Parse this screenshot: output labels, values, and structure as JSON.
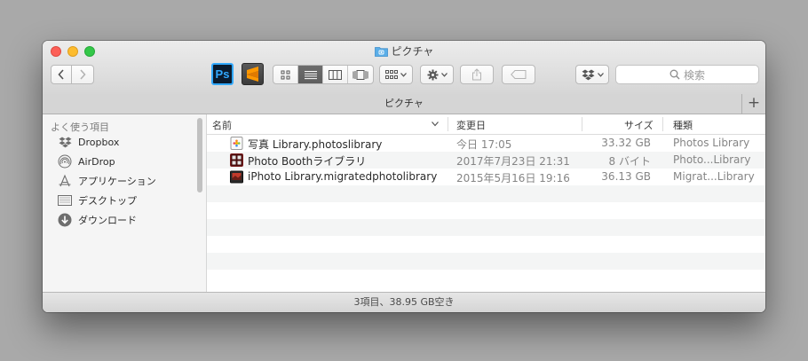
{
  "window": {
    "title": "ピクチャ"
  },
  "toolbar": {
    "back_label": "back",
    "forward_label": "forward",
    "apps": [
      "Ps",
      "S"
    ],
    "search_placeholder": "検索"
  },
  "tab": {
    "title": "ピクチャ",
    "add": "+"
  },
  "sidebar": {
    "heading": "よく使う項目",
    "items": [
      {
        "label": "Dropbox",
        "icon": "dropbox-icon"
      },
      {
        "label": "AirDrop",
        "icon": "airdrop-icon"
      },
      {
        "label": "アプリケーション",
        "icon": "applications-icon"
      },
      {
        "label": "デスクトップ",
        "icon": "desktop-icon"
      },
      {
        "label": "ダウンロード",
        "icon": "downloads-icon"
      }
    ]
  },
  "columns": {
    "name": "名前",
    "date": "変更日",
    "size": "サイズ",
    "kind": "種類"
  },
  "files": [
    {
      "name": "写真 Library.photoslibrary",
      "date": "今日 17:05",
      "size": "33.32 GB",
      "kind": "Photos Library"
    },
    {
      "name": "Photo Boothライブラリ",
      "date": "2017年7月23日 21:31",
      "size": "8 バイト",
      "kind": "Photo...Library"
    },
    {
      "name": "iPhoto Library.migratedphotolibrary",
      "date": "2015年5月16日 19:16",
      "size": "36.13 GB",
      "kind": "Migrat...Library"
    }
  ],
  "status": {
    "text": "3項目、38.95 GB空き"
  },
  "colors": {
    "selected_view": "#5e5e5e",
    "folder_blue": "#5aaee8",
    "ps_blue": "#31a8ff"
  }
}
